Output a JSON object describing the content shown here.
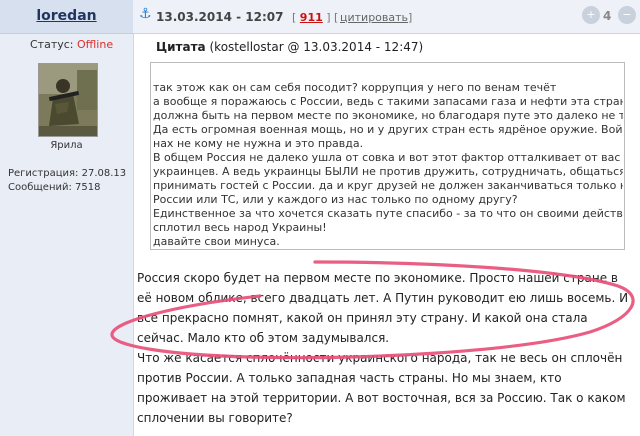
{
  "user": {
    "name": "loredan",
    "status_label": "Статус:",
    "status_value": "Offline",
    "avatar_caption": "Ярила",
    "registration": "Регистрация: 27.08.13",
    "messages": "Сообщений: 7518"
  },
  "header": {
    "anchor_icon": "anchor-icon",
    "date": "13.03.2014 - 12:07",
    "rating_open": "[",
    "rating": "911",
    "rating_close": "] [",
    "quote_link": "цитировать",
    "quote_link_close": "]",
    "vote_count": "4"
  },
  "quote": {
    "title": "Цитата",
    "meta": "(kostellostar @ 13.03.2014 - 12:47)",
    "lines": [
      "так этож как он сам себя посодит? коррупция у него по венам течёт",
      "а вообще я поражаюсь с России, ведь с такими запасами газа и нефти эта страна",
      "должна быть на первом месте по экономике, но благодаря путе это далеко не так.",
      "Да есть огромная военная мощь, но и у других стран есть ядрёное оружие. Война",
      "нах не кому не нужна и это правда.",
      "В общем Россия не далеко ушла от совка и вот этот фактор отталкивает от вас нас",
      "украинцев. А ведь украинцы БЫЛИ не против дружить, сотрудничать, общаться,",
      "принимать гостей с России. да и круг друзей не должен заканчиваться только на",
      "России или ТС, или у каждого из нас только по одному другу?",
      "Единственное за что хочется сказать путе спасибо - за то что он своими действиями",
      "сплотил весь народ Украины!",
      "давайте свои минуса."
    ]
  },
  "post": {
    "lines": [
      "Россия скоро будет на первом месте по экономике. Просто нашей стране в",
      "её новом облике, всего двадцать лет. А Путин руководит ею лишь восемь. И",
      "все прекрасно помнят, какой он принял эту страну. И какой она стала",
      "сейчас. Мало кто об этом задумывался.",
      "Что же касается сплочённости украинского народа, так не весь он сплочён",
      "против России. А только западная часть страны. Но мы знаем, кто",
      "проживает на этой территории. А вот восточная, вся за Россию. Так о каком",
      "сплочении вы говорите?"
    ]
  },
  "colors": {
    "status_offline": "#d93030",
    "rating": "#cc1111",
    "highlight_ink": "#e8507a"
  }
}
